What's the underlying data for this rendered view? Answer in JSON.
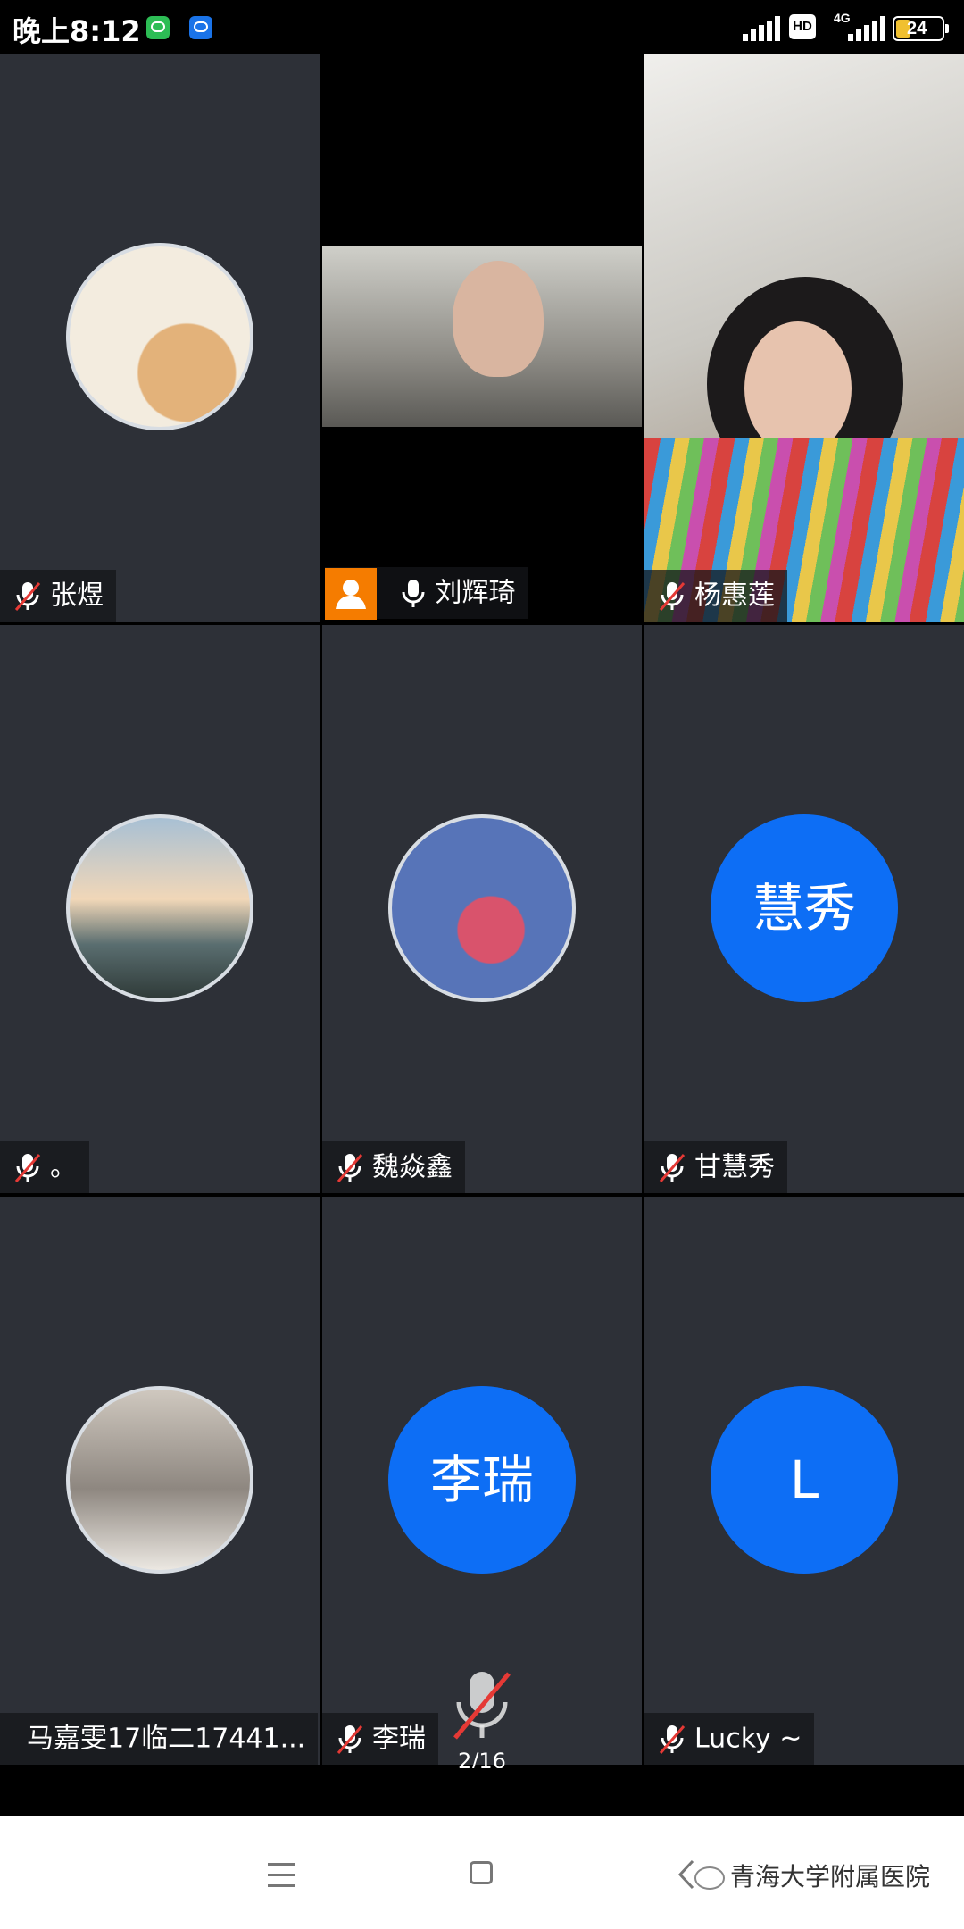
{
  "status_bar": {
    "time": "晚上8:12",
    "network_badge": "HD",
    "network_type": "4G",
    "battery_level": "24"
  },
  "participants": [
    {
      "name": "张煜",
      "muted": true,
      "avatar": "cat-photo"
    },
    {
      "name": "刘辉琦",
      "muted": false,
      "video": true,
      "active_speaker": true,
      "host": true
    },
    {
      "name": "杨惠莲",
      "muted": true,
      "video": true
    },
    {
      "name": "。",
      "muted": true,
      "avatar": "sky-photo"
    },
    {
      "name": "魏焱鑫",
      "muted": true,
      "avatar": "roses-photo"
    },
    {
      "name": "甘慧秀",
      "muted": true,
      "avatar_text": "慧秀"
    },
    {
      "name": "马嘉雯17临二17441...",
      "muted": false,
      "avatar": "girl-photo"
    },
    {
      "name": "李瑞",
      "muted": true,
      "avatar_text": "李瑞"
    },
    {
      "name": "Lucky ~",
      "muted": true,
      "avatar_text": "L"
    }
  ],
  "page_indicator": "2/16",
  "nav": {
    "watermark": "青海大学附属医院"
  },
  "colors": {
    "tile_bg": "#2d3037",
    "avatar_blue": "#0d6ef5",
    "active_border": "#38c172",
    "mute_red": "#e53935",
    "host_orange": "#f57c00"
  }
}
